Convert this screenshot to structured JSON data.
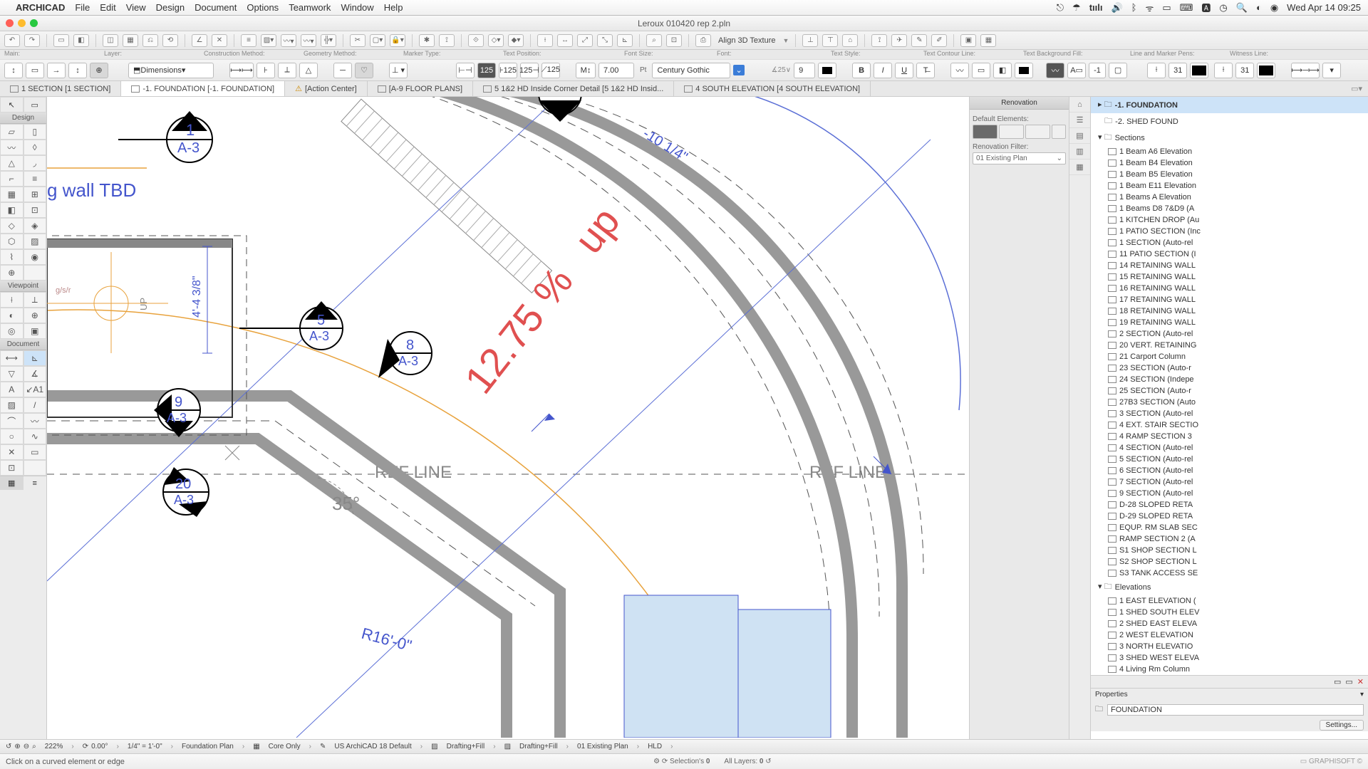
{
  "menubar": {
    "app": "ARCHICAD",
    "items": [
      "File",
      "Edit",
      "View",
      "Design",
      "Document",
      "Options",
      "Teamwork",
      "Window",
      "Help"
    ],
    "clock": "Wed Apr 14  09:25"
  },
  "window": {
    "title": "Leroux 010420 rep 2.pln"
  },
  "toolbar": {
    "align3d": "Align 3D Texture"
  },
  "info_labels": {
    "main": "Main:",
    "layer": "Layer:",
    "construction": "Construction Method:",
    "geometry": "Geometry Method:",
    "marker": "Marker Type:",
    "text_pos": "Text Position:",
    "font_size": "Font Size:",
    "font": "Font:",
    "text_style": "Text Style:",
    "contour": "Text Contour Line:",
    "bgfill": "Text Background Fill:",
    "linepen": "Line and Marker Pens:",
    "witness": "Witness Line:"
  },
  "info_row": {
    "layer_value": "Dimensions",
    "font_size_value": "7.00",
    "font_size_unit": "Pt",
    "font_value": "Century Gothic",
    "angle_v": "9",
    "pen1": "31",
    "pen2": "31"
  },
  "tabs": [
    {
      "label": "1 SECTION [1 SECTION]"
    },
    {
      "label": "-1. FOUNDATION [-1. FOUNDATION]",
      "active": true
    },
    {
      "label": "[Action Center]"
    },
    {
      "label": "[A-9 FLOOR PLANS]"
    },
    {
      "label": "5 1&2 HD Inside Corner Detail [5 1&2 HD Insid..."
    },
    {
      "label": "4 SOUTH ELEVATION [4 SOUTH ELEVATION]"
    }
  ],
  "toolbox": {
    "groups": [
      "Design",
      "Viewpoint",
      "Document"
    ]
  },
  "canvas": {
    "note": "g wall TBD",
    "ref_line": "REF LINE",
    "angle": "35°",
    "radius": "R16'-0\"",
    "slope": "12.75 %",
    "slope_dir": "up",
    "dim_cut": "-10 1/4\"",
    "dim_h": "4'-4 3/8\"",
    "up_lbl": "UP",
    "markers": [
      {
        "id": "1",
        "sheet": "A-3"
      },
      {
        "id": "5",
        "sheet": "A-3"
      },
      {
        "id": "8",
        "sheet": "A-3"
      },
      {
        "id": "9",
        "sheet": "A-3"
      },
      {
        "id": "20",
        "sheet": "A-3"
      }
    ]
  },
  "renovation": {
    "title": "Renovation",
    "default_lbl": "Default Elements:",
    "filter_lbl": "Renovation Filter:",
    "filter_value": "01 Existing Plan"
  },
  "navigator": {
    "root": "-1. FOUNDATION",
    "root2": "-2. SHED FOUND",
    "sections_label": "Sections",
    "sections": [
      "1 Beam A6 Elevation",
      "1 Beam B4 Elevation",
      "1 Beam B5 Elevation",
      "1 Beam E11 Elevation",
      "1 Beams A Elevation",
      "1 Beams D8 7&D9 (A",
      "1 KITCHEN DROP (Au",
      "1 PATIO SECTION (Inc",
      "1 SECTION (Auto-rel",
      "11 PATIO SECTION (I",
      "14 RETAINING WALL",
      "15 RETAINING WALL",
      "16 RETAINING WALL",
      "17 RETAINING WALL",
      "18 RETAINING WALL",
      "19 RETAINING WALL",
      "2 SECTION (Auto-rel",
      "20 VERT. RETAINING",
      "21 Carport Column",
      "23 SECTION (Auto-r",
      "24 SECTION (Indepe",
      "25 SECTION (Auto-r",
      "27B3 SECTION (Auto",
      "3 SECTION (Auto-rel",
      "4 EXT. STAIR SECTIO",
      "4 RAMP SECTION 3",
      "4 SECTION (Auto-rel",
      "5 SECTION (Auto-rel",
      "6 SECTION (Auto-rel",
      "7 SECTION (Auto-rel",
      "9 SECTION (Auto-rel",
      "D-28 SLOPED RETA",
      "D-29 SLOPED RETA",
      "EQUP. RM SLAB SEC",
      "RAMP SECTION 2 (A",
      "S1 SHOP SECTION L",
      "S2 SHOP SECTION L",
      "S3 TANK ACCESS SE"
    ],
    "elevations_label": "Elevations",
    "elevations": [
      "1 EAST ELEVATION (",
      "1 SHED SOUTH ELEV",
      "2 SHED EAST ELEVA",
      "2 WEST ELEVATION",
      "3 NORTH ELEVATIO",
      "3 SHED WEST ELEVA",
      "4 Living Rm Column"
    ],
    "props_title": "Properties",
    "props_value": "FOUNDATION",
    "settings": "Settings..."
  },
  "status": {
    "zoom": "222%",
    "rot": "0.00°",
    "scale": "1/4\"  =  1'-0\"",
    "story": "Foundation Plan",
    "core": "Core Only",
    "template": "US ArchiCAD 18 Default",
    "df1": "Drafting+Fill",
    "df2": "Drafting+Fill",
    "reno": "01 Existing Plan",
    "hld": "HLD",
    "sel_lbl": "Selection's",
    "sel_val": "0",
    "layers_lbl": "All Layers:",
    "layers_val": "0"
  },
  "hint": {
    "text": "Click on a curved element or edge",
    "brand": "GRAPHISOFT ©"
  }
}
